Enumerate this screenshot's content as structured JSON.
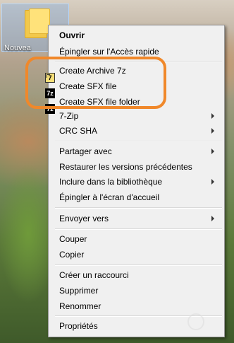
{
  "desktop": {
    "icon_label": "Nouvea",
    "icon_name": "folder-icon"
  },
  "menu": {
    "open": "Ouvrir",
    "pin_quick": "Épingler sur l'Accès rapide",
    "create_archive": "Create Archive 7z",
    "create_sfx": "Create SFX file",
    "create_sfx_folder": "Create SFX file folder",
    "sevenzip": "7-Zip",
    "crc": "CRC SHA",
    "share": "Partager avec",
    "restore": "Restaurer les versions précédentes",
    "include_lib": "Inclure dans la bibliothèque",
    "pin_start": "Épingler à l'écran d'accueil",
    "send_to": "Envoyer vers",
    "cut": "Couper",
    "copy": "Copier",
    "shortcut": "Créer un raccourci",
    "delete": "Supprimer",
    "rename": "Renommer",
    "properties": "Propriétés"
  },
  "icons": {
    "archive_glyph": "7",
    "sfx_glyph": "7z",
    "sfx_folder_glyph": "7z"
  },
  "colors": {
    "highlight": "#f0882a",
    "menu_bg": "#f0f0f0"
  }
}
